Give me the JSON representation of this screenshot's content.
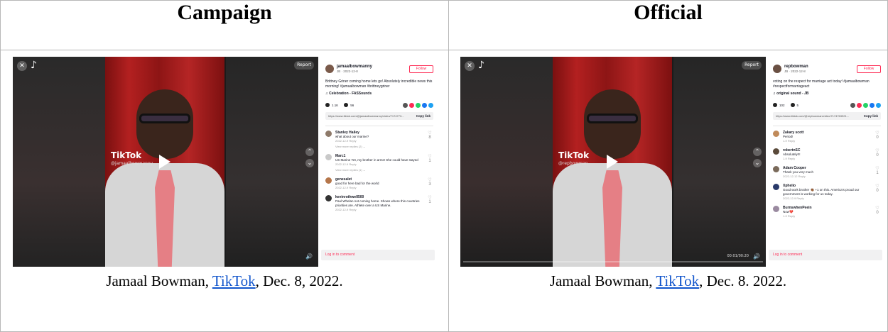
{
  "headers": {
    "left": "Campaign",
    "right": "Official"
  },
  "left": {
    "video": {
      "watermark": "TikTok",
      "username": "@jamaalbowmanny",
      "report": "Report"
    },
    "panel": {
      "name": "jamaalbowmanny",
      "sub": "JB · 2022-12-8",
      "follow": "Follow",
      "caption": "Brittney Griner coming home lets go! Absolutely incredible news this morning! #jamaalbowman #brittneygriner",
      "sound": "♫ Celebration - FASSounds",
      "likes": "1.1K",
      "comments_count": "56",
      "link": "https://www.tiktok.com/@jamaalbowmanny/video/7174773...",
      "copy": "Copy link",
      "comments": [
        {
          "user": "Stanley Hailey",
          "text": "what about our marine?",
          "meta": "2022-12-9 Reply",
          "more": "View more replies (2) ⌄",
          "likes": "8"
        },
        {
          "user": "Marc1",
          "text": "US Marine Yet, my brother in arms! She could have stayed",
          "meta": "2022-12-9 Reply",
          "more": "View more replies (1) ⌄",
          "likes": "1"
        },
        {
          "user": "genesalet",
          "text": "good for here bad for the world",
          "meta": "2022-12-9 Reply",
          "more": "",
          "likes": "3"
        },
        {
          "user": "kevinrothwell500",
          "text": "Paul Whelan not coming home. Shows where this countries priorities are. Athlete over a US Marine.",
          "meta": "2022-12-9 Reply",
          "more": "",
          "likes": "1"
        }
      ],
      "login": "Log in to comment"
    },
    "caption": {
      "before": "Jamaal Bowman, ",
      "link": "TikTok",
      "after": ", Dec. 8, 2022."
    }
  },
  "right": {
    "video": {
      "watermark": "TikTok",
      "username": "@repbowman",
      "report": "Report",
      "time": "00:01/00:20"
    },
    "panel": {
      "name": "repbowman",
      "sub": "JB · 2022-12-8",
      "follow": "Follow",
      "caption": "voting on the respect for marriage act today! #jamaalbowman #respectformarriageact",
      "sound": "♫ original sound - JB",
      "likes": "102",
      "comments_count": "5",
      "link": "https://www.tiktok.com/@repbowman/video/7174763921...",
      "copy": "Copy link",
      "comments": [
        {
          "user": "Zakary scott",
          "text": "Period!",
          "meta": "1-9 Reply",
          "more": "",
          "likes": "0"
        },
        {
          "user": "robertnSC",
          "text": "Absolutely!!!",
          "meta": "1-9 Reply",
          "more": "",
          "likes": "0"
        },
        {
          "user": "Adam Cooper",
          "text": "Thank you very much",
          "meta": "2022-12-12 Reply",
          "more": "",
          "likes": "1"
        },
        {
          "user": "Xphelio",
          "text": "Good work brother 👏🏾 +1 on this. America's proud our government is working for us today.",
          "meta": "2022-12-9 Reply",
          "more": "",
          "likes": "0"
        },
        {
          "user": "BurnswhenPeein",
          "text": "Now💔",
          "meta": "1-9 Reply",
          "more": "",
          "likes": "0"
        }
      ],
      "login": "Log in to comment"
    },
    "caption": {
      "before": "Jamaal Bowman, ",
      "link": "TikTok",
      "after": ", Dec. 8. 2022."
    }
  }
}
